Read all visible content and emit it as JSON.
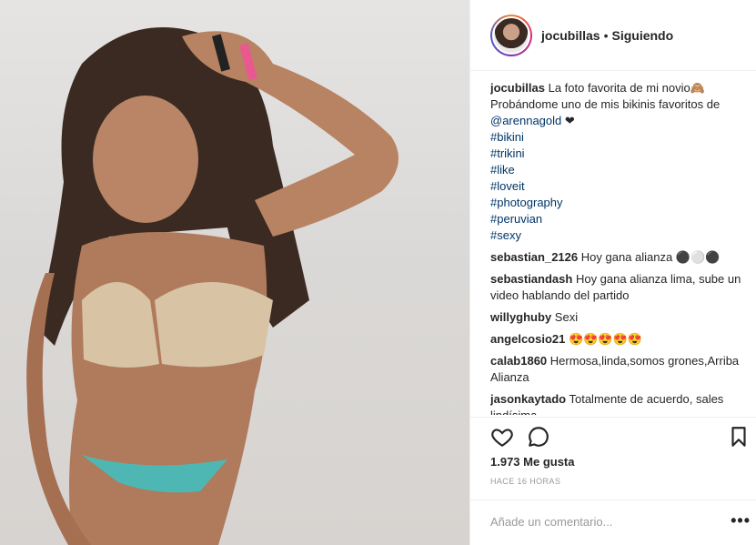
{
  "header": {
    "username": "jocubillas",
    "separator": "•",
    "follow_state": "Siguiendo"
  },
  "caption": {
    "username": "jocubillas",
    "text": "La foto favorita de mi novio🙈 Probándome uno de mis bikinis favoritos de",
    "mention": "@arennagold",
    "emoji": "❤",
    "hashtags": [
      "#bikini",
      "#trikini",
      "#like",
      "#loveit",
      "#photography",
      "#peruvian",
      "#sexy"
    ]
  },
  "comments": [
    {
      "user": "sebastian_2126",
      "text": "Hoy gana alianza ⚫⚪⚫"
    },
    {
      "user": "sebastiandash",
      "text": "Hoy gana alianza lima, sube un video hablando del partido"
    },
    {
      "user": "willyghuby",
      "text": "Sexi"
    },
    {
      "user": "angelcosio21",
      "text": "😍😍😍😍😍"
    },
    {
      "user": "calab1860",
      "text": "Hermosa,linda,somos grones,Arriba Alianza"
    },
    {
      "user": "jasonkaytado",
      "text": "Totalmente de acuerdo, sales lindísima"
    }
  ],
  "actions": {
    "like_icon": "heart-icon",
    "comment_icon": "speech-bubble-icon",
    "save_icon": "bookmark-icon"
  },
  "likes": "1.973 Me gusta",
  "time": "HACE 16 HORAS",
  "comment_input": {
    "placeholder": "Añade un comentario..."
  },
  "more_label": "•••"
}
